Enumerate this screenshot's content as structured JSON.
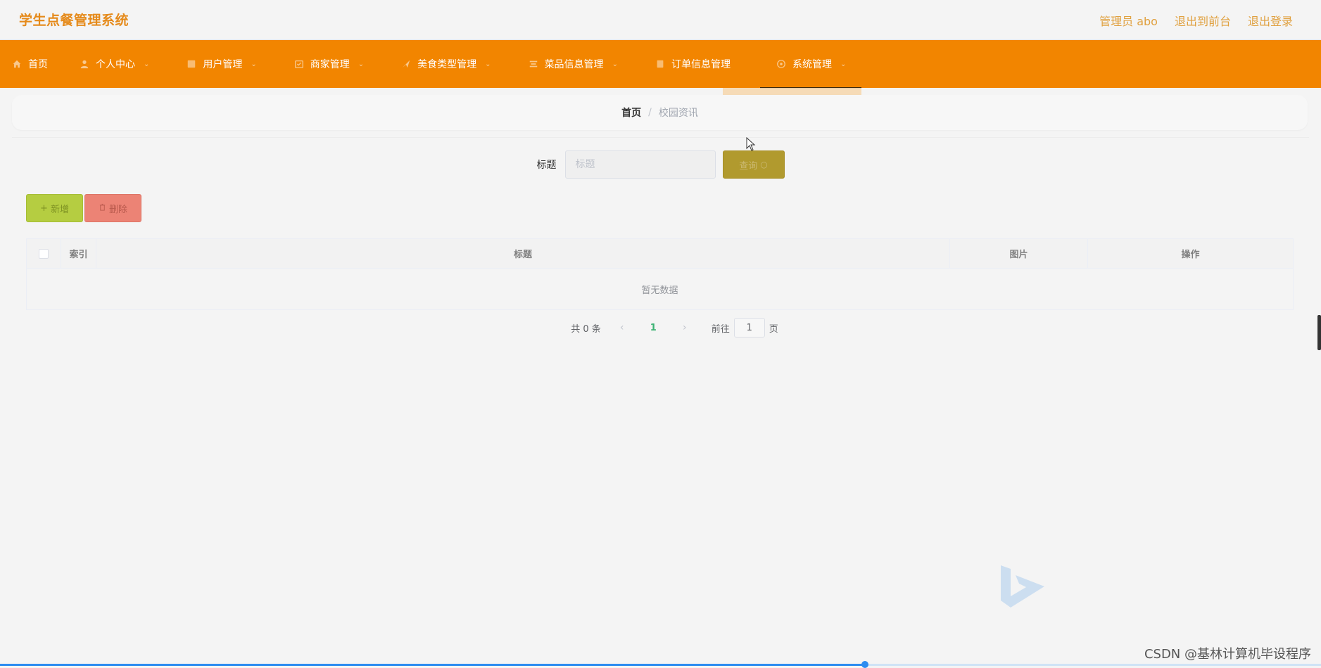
{
  "header": {
    "app_title": "学生点餐管理系统",
    "links": {
      "admin": "管理员 abo",
      "to_front": "退出到前台",
      "logout": "退出登录"
    }
  },
  "nav": {
    "items": [
      {
        "label": "首页",
        "icon": "home-icon"
      },
      {
        "label": "个人中心",
        "icon": "user-icon"
      },
      {
        "label": "用户管理",
        "icon": "users-icon"
      },
      {
        "label": "商家管理",
        "icon": "store-icon"
      },
      {
        "label": "美食类型管理",
        "icon": "category-icon"
      },
      {
        "label": "菜品信息管理",
        "icon": "dish-icon"
      },
      {
        "label": "订单信息管理",
        "icon": "order-icon"
      },
      {
        "label": "系统管理",
        "icon": "settings-icon"
      }
    ]
  },
  "breadcrumb": {
    "home": "首页",
    "separator": "/",
    "current": "校园资讯"
  },
  "search": {
    "label": "标题",
    "placeholder": "标题",
    "button_label": "查询"
  },
  "actions": {
    "add_label": "新增",
    "delete_label": "删除"
  },
  "table": {
    "columns": {
      "index": "索引",
      "title": "标题",
      "image": "图片",
      "ops": "操作"
    },
    "empty_text": "暂无数据"
  },
  "pagination": {
    "total": "共 0 条",
    "prev": "‹",
    "current_page": "1",
    "next": "›",
    "goto_label": "前往",
    "goto_value": "1",
    "goto_suffix": "页"
  },
  "progress": 0.655,
  "watermark": "CSDN @基林计算机毕设程序",
  "colors": {
    "nav_bg": "#f28500",
    "title_color": "#e58a1a",
    "search_button": "#b19a2e",
    "add_button": "#b5cd41",
    "delete_button": "#ec8375",
    "page_active": "#3bb273"
  }
}
